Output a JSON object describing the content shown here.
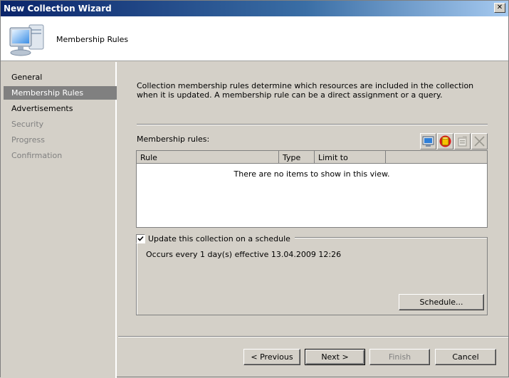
{
  "window": {
    "title": "New Collection Wizard",
    "close_symbol": "✕"
  },
  "header": {
    "title": "Membership Rules",
    "icon": "computer-icon"
  },
  "nav": {
    "items": [
      {
        "label": "General",
        "state": "normal"
      },
      {
        "label": "Membership Rules",
        "state": "active"
      },
      {
        "label": "Advertisements",
        "state": "normal"
      },
      {
        "label": "Security",
        "state": "disabled"
      },
      {
        "label": "Progress",
        "state": "disabled"
      },
      {
        "label": "Confirmation",
        "state": "disabled"
      }
    ]
  },
  "content": {
    "description": "Collection membership rules determine which resources are included in the collection when it is updated. A membership rule can be a direct assignment or a query.",
    "rules_label": "Membership rules:",
    "toolbar": [
      {
        "icon": "new-direct-rule-icon"
      },
      {
        "icon": "new-query-rule-icon"
      },
      {
        "icon": "properties-icon",
        "disabled": true
      },
      {
        "icon": "delete-icon",
        "disabled": true
      }
    ],
    "columns": [
      "Rule",
      "Type",
      "Limit to"
    ],
    "empty_text": "There are no items to show in this view.",
    "schedule": {
      "checkbox_label": "Update this collection on a schedule",
      "checked": true,
      "occurs_text": "Occurs every 1 day(s) effective 13.04.2009 12:26",
      "schedule_button": "Schedule..."
    }
  },
  "footer": {
    "previous": "< Previous",
    "next": "Next >",
    "finish": "Finish",
    "cancel": "Cancel"
  }
}
